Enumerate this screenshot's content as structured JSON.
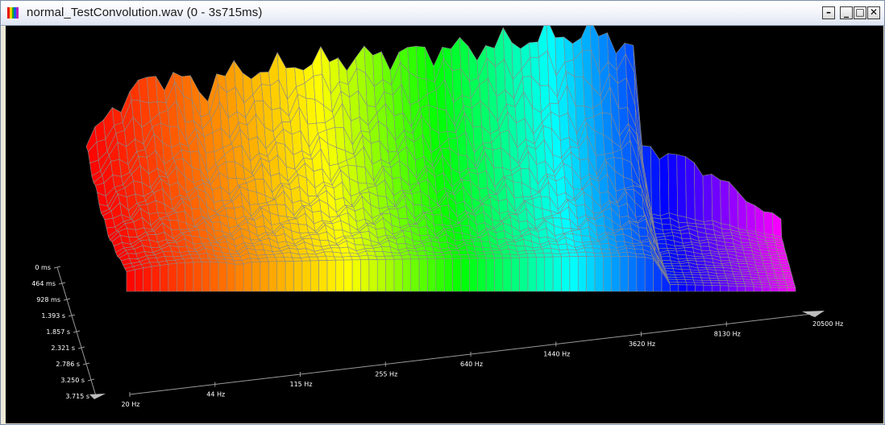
{
  "window": {
    "title": "normal_TestConvolution.wav (0 - 3s715ms)",
    "icon": "color-bars-icon",
    "controls": {
      "restore_child": "–",
      "minimize": "_",
      "maximize": "□",
      "close": "✕"
    }
  },
  "plot": {
    "background": "#000000",
    "mesh_color": "#8a8a8a",
    "colormap": [
      "#ff0000",
      "#ff8000",
      "#ffff00",
      "#00ff00",
      "#00ffff",
      "#0000ff",
      "#ff00ff"
    ],
    "time_axis": {
      "ticks": [
        "0 ms",
        "464 ms",
        "928 ms",
        "1.393 s",
        "1.857 s",
        "2.321 s",
        "2.786 s",
        "3.250 s",
        "3.715 s"
      ]
    },
    "freq_axis": {
      "ticks": [
        "20 Hz",
        "44 Hz",
        "115 Hz",
        "255 Hz",
        "640 Hz",
        "1440 Hz",
        "3620 Hz",
        "8130 Hz",
        "20500 Hz"
      ]
    }
  }
}
